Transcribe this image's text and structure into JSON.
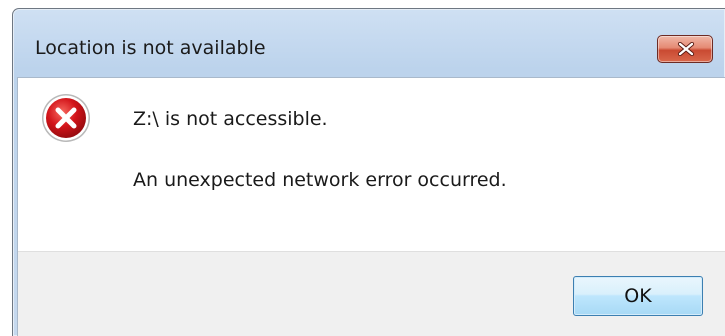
{
  "dialog": {
    "title": "Location is not available",
    "message": "Z:\\ is not accessible.",
    "detail": "An unexpected network error occurred.",
    "ok_label": "OK",
    "icon": "error-icon"
  },
  "colors": {
    "error_red": "#d3141a",
    "close_red": "#c94a32",
    "title_bar": "#bcd3ec",
    "footer": "#f0f0f0",
    "ok_border": "#3c7fb1"
  }
}
